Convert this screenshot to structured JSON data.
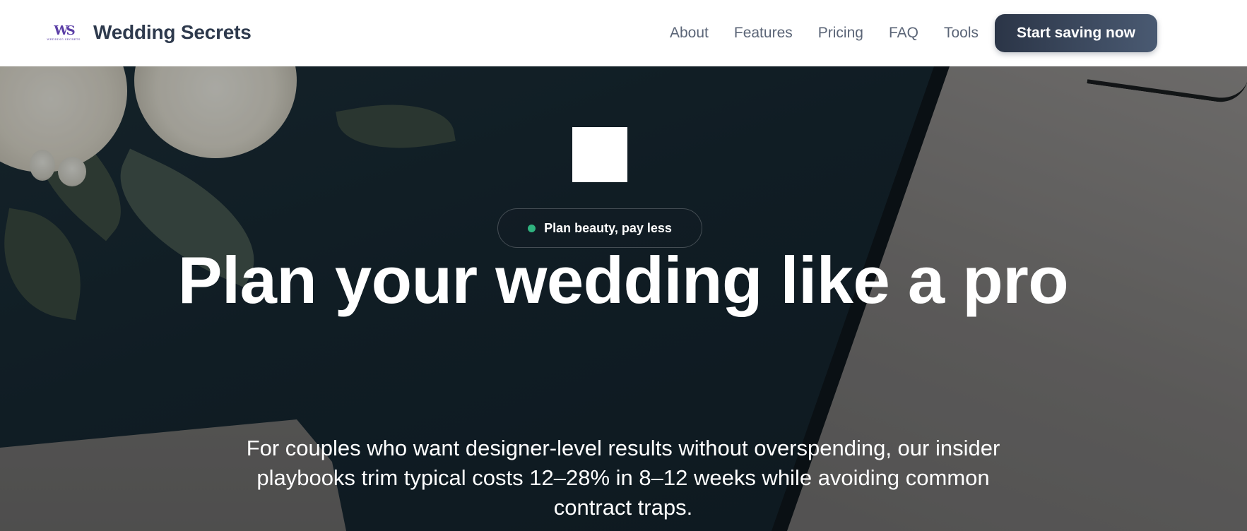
{
  "header": {
    "logo_monogram": "WS",
    "logo_text": "WEDDING SECRETS",
    "brand_name": "Wedding Secrets",
    "nav": [
      {
        "label": "About"
      },
      {
        "label": "Features"
      },
      {
        "label": "Pricing"
      },
      {
        "label": "FAQ"
      },
      {
        "label": "Tools"
      }
    ],
    "cta_label": "Start saving now"
  },
  "hero": {
    "badge_label": "Plan beauty, pay less",
    "badge_dot_color": "#2fb37f",
    "headline": "Plan your wedding like a pro",
    "subtext": "For couples who want designer-level results without overspending, our insider playbooks trim typical costs 12–28% in 8–12 weeks while avoiding common contract traps.",
    "icon": "white-square-icon"
  },
  "colors": {
    "brand_text": "#2e3a4d",
    "nav_text": "#5b6577",
    "cta_gradient_start": "#2b3547",
    "cta_gradient_end": "#4a5a72",
    "logo": "#5b3ea6"
  }
}
